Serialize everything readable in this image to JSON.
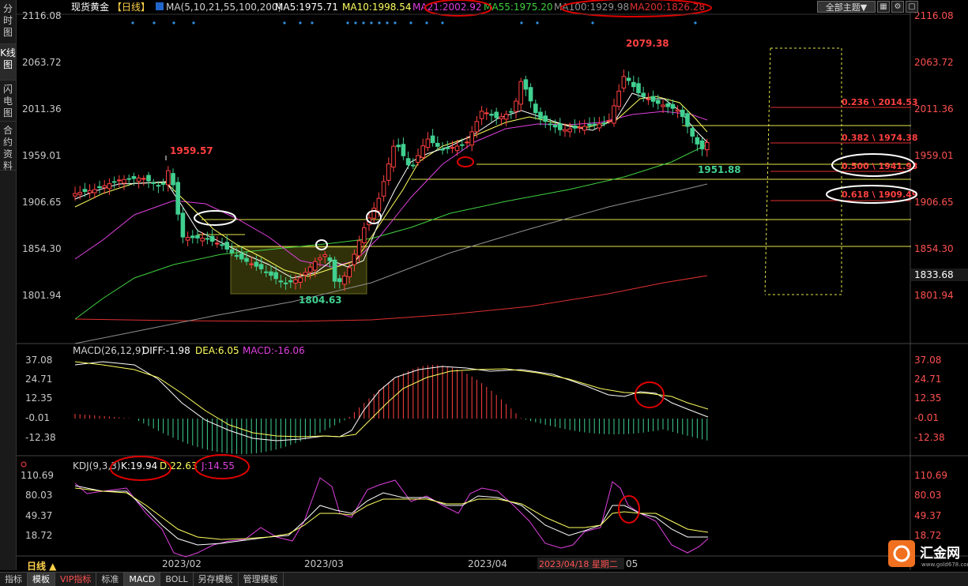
{
  "left_tabs": [
    "分时图",
    "K线图",
    "闪电图",
    "合约资料"
  ],
  "header": {
    "title": "现货黄金",
    "period_tag": "【日线】",
    "ma_label": "MA(5,10,21,55,100,200)",
    "ma5": "MA5:1975.71",
    "ma10": "MA10:1998.54",
    "ma21": "MA21:2002.92",
    "ma55": "MA55:1975.20",
    "ma100": "MA100:1929.98",
    "ma200": "MA200:1826.28",
    "theme": "全部主题▼"
  },
  "price_axis": {
    "ticks": [
      "2116.08",
      "2063.72",
      "2011.36",
      "1959.01",
      "1906.65",
      "1854.30",
      "1801.94"
    ],
    "current": "1833.68"
  },
  "annotations": {
    "high_left": "1959.57",
    "low": "1804.63",
    "high_peak": "2079.38",
    "recent_low": "1951.88"
  },
  "fib_levels": [
    {
      "label": "0.236 \\ 2014.53"
    },
    {
      "label": "0.382 \\ 1974.38"
    },
    {
      "label": "0.500 \\ 1941.93"
    },
    {
      "label": "0.618 \\ 1909.49"
    }
  ],
  "macd": {
    "label": "MACD(26,12,9)",
    "diff": "DIFF:-1.98",
    "dea": "DEA:6.05",
    "macd": "MACD:-16.06",
    "ticks": [
      "37.08",
      "24.71",
      "12.35",
      "-0.01",
      "-12.38"
    ]
  },
  "kdj": {
    "label": "KDJ(9,3,3)",
    "k": "K:19.94",
    "d": "D:22.63",
    "j": "J:14.55",
    "ticks": [
      "110.69",
      "80.03",
      "49.37",
      "18.72"
    ]
  },
  "time_axis": {
    "labels": [
      "2023/02",
      "2023/03",
      "2023/04",
      "2023/04/18 星期二",
      "05"
    ]
  },
  "period": "日线 ▲",
  "bottom_tabs": [
    "指标",
    "模板",
    "VIP指标",
    "标准",
    "MACD",
    "BOLL",
    "另存模板",
    "管理模板"
  ],
  "logo": {
    "name": "汇金网",
    "url_text": "www.gold678.com"
  },
  "colors": {
    "up": "#ff4040",
    "down": "#40d090",
    "ma5": "#ffffff",
    "ma10": "#ffff60",
    "ma21": "#e040e0",
    "ma55": "#40d040",
    "ma100": "#909090",
    "ma200": "#e03030"
  }
}
